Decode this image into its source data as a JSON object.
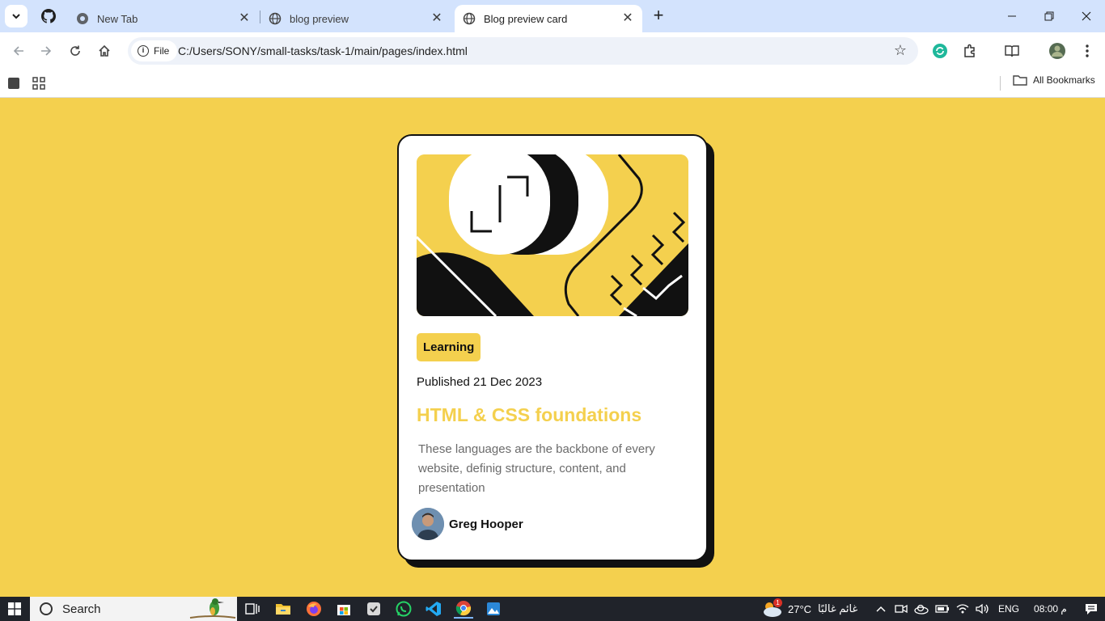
{
  "browser": {
    "tabs": [
      {
        "title": "New Tab",
        "state": "inactive"
      },
      {
        "title": "blog preview",
        "state": "inactive"
      },
      {
        "title": "Blog preview card",
        "state": "active"
      }
    ],
    "address": {
      "scheme_label": "File",
      "url": "C:/Users/SONY/small-tasks/task-1/main/pages/index.html"
    },
    "bookmarks": {
      "all_label": "All Bookmarks"
    }
  },
  "card": {
    "tag": "Learning",
    "published": "Published 21 Dec 2023",
    "title": "HTML & CSS foundations",
    "description": "These languages are the backbone of every website, definig structure, content, and presentation",
    "author": "Greg Hooper"
  },
  "taskbar": {
    "search_label": "Search",
    "weather_temp": "27°C",
    "weather_desc": "غائم غالبًا",
    "weather_badge": "1",
    "language": "ENG",
    "clock": "08:00 م"
  },
  "colors": {
    "accent": "#f4d04e",
    "card_text": "#111111",
    "tab_strip": "#d3e3fd"
  }
}
